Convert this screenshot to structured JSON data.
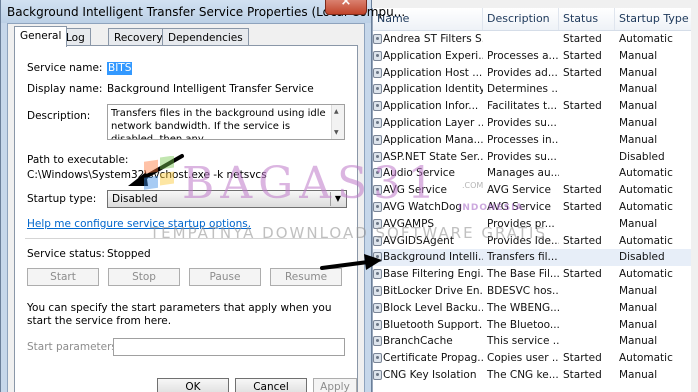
{
  "dialog": {
    "title": "Background Intelligent Transfer Service Properties (Local Compu...",
    "close_symbol": "×",
    "tabs": [
      "General",
      "Log On",
      "Recovery",
      "Dependencies"
    ],
    "service_name_label": "Service name:",
    "service_name_value": "BITS",
    "display_name_label": "Display name:",
    "display_name_value": "Background Intelligent Transfer Service",
    "description_label": "Description:",
    "description_value": "Transfers files in the background using idle network bandwidth. If the service is disabled, then any",
    "path_label": "Path to executable:",
    "path_value": "C:\\Windows\\System32\\svchost.exe -k netsvcs",
    "startup_type_label": "Startup type:",
    "startup_type_value": "Disabled",
    "help_link": "Help me configure service startup options.",
    "service_status_label": "Service status:",
    "service_status_value": "Stopped",
    "buttons": {
      "start": "Start",
      "stop": "Stop",
      "pause": "Pause",
      "resume": "Resume"
    },
    "start_params_info": "You can specify the start parameters that apply when you start the service from here.",
    "start_params_label": "Start parameters:",
    "footer_buttons": {
      "ok": "OK",
      "cancel": "Cancel",
      "apply": "Apply"
    }
  },
  "services": {
    "columns": {
      "name": "Name",
      "description": "Description",
      "status": "Status",
      "startup_type": "Startup Type"
    },
    "rows": [
      {
        "name": "Andrea ST Filters S...",
        "description": "",
        "status": "Started",
        "startup": "Automatic"
      },
      {
        "name": "Application Experi...",
        "description": "Processes a...",
        "status": "Started",
        "startup": "Manual"
      },
      {
        "name": "Application Host ...",
        "description": "Provides ad...",
        "status": "Started",
        "startup": "Manual"
      },
      {
        "name": "Application Identity",
        "description": "Determines ...",
        "status": "",
        "startup": "Manual"
      },
      {
        "name": "Application Infor...",
        "description": "Facilitates t...",
        "status": "Started",
        "startup": "Manual"
      },
      {
        "name": "Application Layer ...",
        "description": "Provides su...",
        "status": "",
        "startup": "Manual"
      },
      {
        "name": "Application Mana...",
        "description": "Processes in...",
        "status": "",
        "startup": "Manual"
      },
      {
        "name": "ASP.NET State Ser...",
        "description": "Provides su...",
        "status": "",
        "startup": "Disabled"
      },
      {
        "name": "Audio Service",
        "description": "Manages au...",
        "status": "",
        "startup": "Automatic"
      },
      {
        "name": "AVG Service",
        "description": "AVG Service",
        "status": "Started",
        "startup": "Automatic"
      },
      {
        "name": "AVG WatchDog",
        "description": "AVG Service",
        "status": "Started",
        "startup": "Automatic"
      },
      {
        "name": "AVGAMPS",
        "description": "Provides pr...",
        "status": "",
        "startup": "Manual"
      },
      {
        "name": "AVGIDSAgent",
        "description": "Provides Ide...",
        "status": "Started",
        "startup": "Automatic"
      },
      {
        "name": "Background Intelli...",
        "description": "Transfers fil...",
        "status": "",
        "startup": "Disabled"
      },
      {
        "name": "Base Filtering Engi...",
        "description": "The Base Fil...",
        "status": "Started",
        "startup": "Automatic"
      },
      {
        "name": "BitLocker Drive En...",
        "description": "BDESVC hos...",
        "status": "",
        "startup": "Manual"
      },
      {
        "name": "Block Level Backu...",
        "description": "The WBENG...",
        "status": "",
        "startup": "Manual"
      },
      {
        "name": "Bluetooth Support...",
        "description": "The Bluetoo...",
        "status": "",
        "startup": "Manual"
      },
      {
        "name": "BranchCache",
        "description": "This service ...",
        "status": "",
        "startup": "Manual"
      },
      {
        "name": "Certificate Propag...",
        "description": "Copies user ...",
        "status": "Started",
        "startup": "Automatic"
      },
      {
        "name": "CNG Key Isolation",
        "description": "The CNG ke...",
        "status": "Started",
        "startup": "Manual"
      }
    ]
  },
  "watermark": {
    "brand": "BAGAS31",
    "domain": ".COM",
    "sub": "INDONESIA",
    "tagline": "TEMPATNYA DOWNLOAD SOFTWARE GRATIS"
  }
}
